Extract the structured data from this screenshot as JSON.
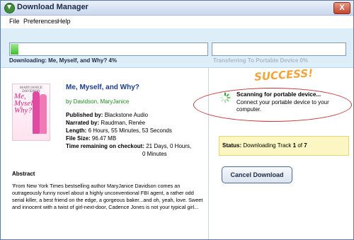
{
  "window": {
    "title": "Download Manager",
    "close_label": "X"
  },
  "menu": [
    "File",
    "Preferences",
    "Help"
  ],
  "download": {
    "label": "Downloading: Me, Myself, and Why?  4%",
    "progress": 0.04
  },
  "transfer": {
    "label": "Transferring To Portable Device 0%",
    "progress": 0
  },
  "cover": {
    "author": "MARYJANICE DAVIDSON",
    "title_lines": [
      "Me,",
      "Myself,",
      "Why?"
    ]
  },
  "book": {
    "title": "Me, Myself, and Why?",
    "author": "by Davidson, MaryJanice",
    "published_by_label": "Published by:",
    "published_by": "Blackstone Audio",
    "narrated_by_label": "Narrated by:",
    "narrated_by": "Raudman, Renée",
    "length_label": "Length:",
    "length": "6 Hours, 55 Minutes, 53 Seconds",
    "file_size_label": "File Size:",
    "file_size": "96.47 MB",
    "remaining_label": "Time remaining on checkout:",
    "remaining_line1": "21 Days, 0 Hours,",
    "remaining_line2": "0 Minutes"
  },
  "abstract": {
    "heading": "Abstract",
    "text": "'From New York Times bestselling author MaryJanice Davidson comes an outrageously funny novel about a highly unconventional FBI agent, a rather odd serial killer, a best friend on the edge, a gorgeous baker...and oh, yeah, love. Sweet and innocent with a twist of girl-next-door, Cadence Jones is not your typical girl..."
  },
  "annotation": {
    "success": "SUCCESS!"
  },
  "scan": {
    "title": "Scanning for portable device...",
    "message": "Connect your portable device to your computer."
  },
  "status": {
    "label": "Status:",
    "text": "Downloading Track",
    "current": "1",
    "of": "of",
    "total": "7"
  },
  "buttons": {
    "cancel": "Cancel Download"
  }
}
